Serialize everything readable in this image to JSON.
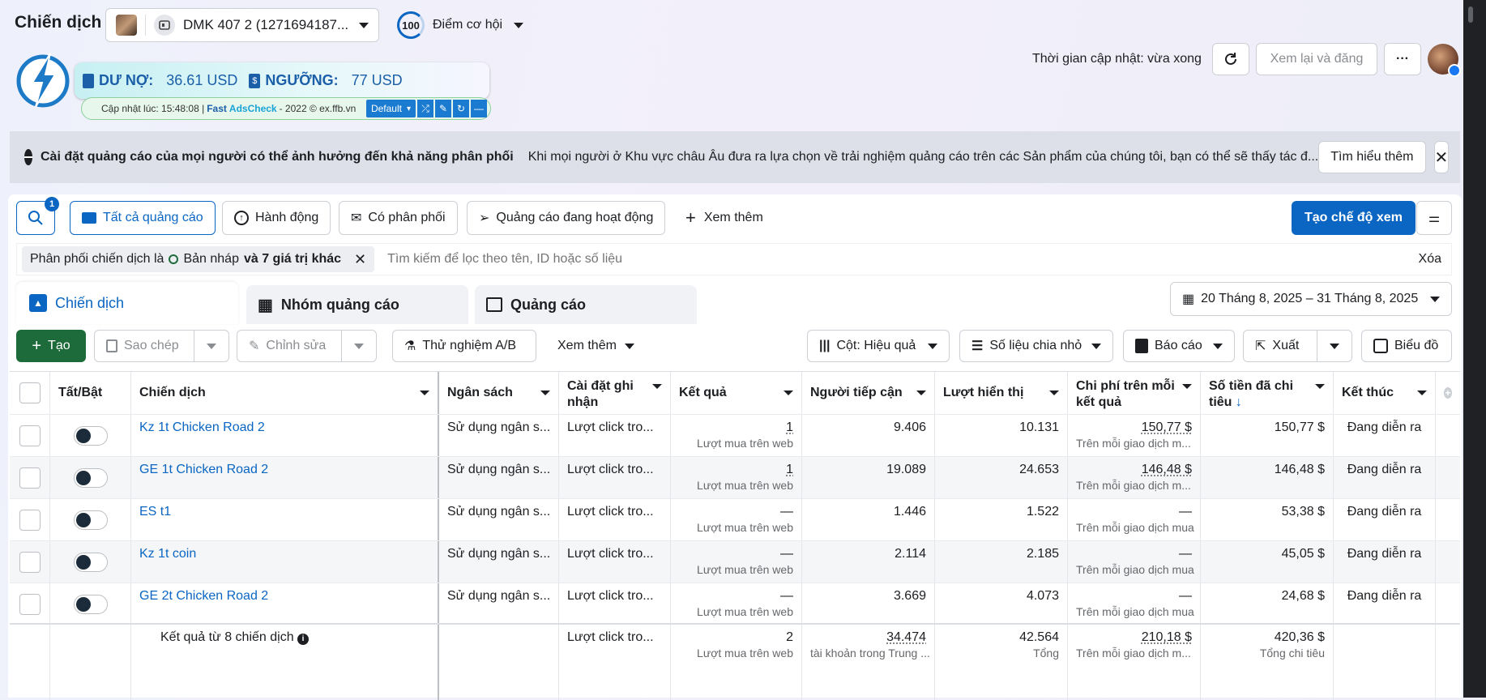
{
  "header": {
    "title": "Chiến dịch",
    "account_name": "DMK 407 2 (1271694187...",
    "score_value": "100",
    "score_label": "Điểm cơ hội",
    "update_time": "Thời gian cập nhật: vừa xong",
    "review_publish": "Xem lại và đăng"
  },
  "adscheck": {
    "debt_label": "DƯ NỢ:",
    "debt_value": "36.61 USD",
    "threshold_label": "NGƯỠNG:",
    "threshold_value": "77 USD",
    "footer_prefix": "Cập nhật lúc: 15:48:08 |",
    "footer_brand_fast": "Fast",
    "footer_brand_name": "AdsCheck",
    "footer_suffix": "- 2022 © ex.ffb.vn",
    "preset": "Default"
  },
  "notice": {
    "title": "Cài đặt quảng cáo của mọi người có thể ảnh hưởng đến khả năng phân phối",
    "text": "Khi mọi người ở Khu vực châu Âu đưa ra lựa chọn về trải nghiệm quảng cáo trên các Sản phẩm của chúng tôi, bạn có thể sẽ thấy tác đ...",
    "learn_more": "Tìm hiểu thêm"
  },
  "filters": {
    "search_badge": "1",
    "all_ads": "Tất cả quảng cáo",
    "actions": "Hành động",
    "delivering": "Có phân phối",
    "active_ads": "Quảng cáo đang hoạt động",
    "see_more": "Xem thêm",
    "create_view": "Tạo chế độ xem",
    "chip_prefix": "Phân phối chiến dịch là",
    "chip_draft": "Bản nháp",
    "chip_suffix": "và 7 giá trị khác",
    "search_placeholder": "Tìm kiếm để lọc theo tên, ID hoặc số liệu",
    "clear": "Xóa"
  },
  "tabs": {
    "campaigns": "Chiến dịch",
    "adsets": "Nhóm quảng cáo",
    "ads": "Quảng cáo",
    "date_range": "20 Tháng 8, 2025 – 31 Tháng 8, 2025"
  },
  "toolbar": {
    "create": "Tạo",
    "duplicate": "Sao chép",
    "edit": "Chỉnh sửa",
    "ab_test": "Thử nghiệm A/B",
    "more": "Xem thêm",
    "columns": "Cột: Hiệu quả",
    "breakdown": "Số liệu chia nhỏ",
    "reports": "Báo cáo",
    "export": "Xuất",
    "charts": "Biểu đồ"
  },
  "table": {
    "headers": {
      "toggle": "Tất/Bật",
      "campaign": "Chiến dịch",
      "budget": "Ngân sách",
      "attribution_1": "Cài đặt ghi",
      "attribution_2": "nhận",
      "results": "Kết quả",
      "reach": "Người tiếp cận",
      "impressions": "Lượt hiển thị",
      "cpr_1": "Chi phí trên mỗi",
      "cpr_2": "kết quả",
      "spent_1": "Số tiền đã chi",
      "spent_2": "tiêu",
      "ends": "Kết thúc"
    },
    "rows": [
      {
        "name": "Kz 1t Chicken Road 2",
        "budget": "Sử dụng ngân s...",
        "attribution": "Lượt click tro...",
        "result": "1",
        "result_sub": "Lượt mua trên web",
        "reach": "9.406",
        "impressions": "10.131",
        "cpr": "150,77 $",
        "cpr_sub": "Trên mỗi giao dịch m...",
        "spent": "150,77 $",
        "ends": "Đang diễn ra"
      },
      {
        "name": "GE 1t Chicken Road 2",
        "budget": "Sử dụng ngân s...",
        "attribution": "Lượt click tro...",
        "result": "1",
        "result_sub": "Lượt mua trên web",
        "reach": "19.089",
        "impressions": "24.653",
        "cpr": "146,48 $",
        "cpr_sub": "Trên mỗi giao dịch m...",
        "spent": "146,48 $",
        "ends": "Đang diễn ra"
      },
      {
        "name": "ES t1",
        "budget": "Sử dụng ngân s...",
        "attribution": "Lượt click tro...",
        "result": "—",
        "result_sub": "Lượt mua trên web",
        "reach": "1.446",
        "impressions": "1.522",
        "cpr": "—",
        "cpr_sub": "Trên mỗi giao dịch mua",
        "spent": "53,38 $",
        "ends": "Đang diễn ra"
      },
      {
        "name": "Kz 1t coin",
        "budget": "Sử dụng ngân s...",
        "attribution": "Lượt click tro...",
        "result": "—",
        "result_sub": "Lượt mua trên web",
        "reach": "2.114",
        "impressions": "2.185",
        "cpr": "—",
        "cpr_sub": "Trên mỗi giao dịch mua",
        "spent": "45,05 $",
        "ends": "Đang diễn ra"
      },
      {
        "name": "GE 2t Chicken Road 2",
        "budget": "Sử dụng ngân s...",
        "attribution": "Lượt click tro...",
        "result": "—",
        "result_sub": "Lượt mua trên web",
        "reach": "3.669",
        "impressions": "4.073",
        "cpr": "—",
        "cpr_sub": "Trên mỗi giao dịch mua",
        "spent": "24,68 $",
        "ends": "Đang diễn ra"
      }
    ],
    "summary": {
      "label": "Kết quả từ 8 chiến dịch",
      "attribution": "Lượt click tro...",
      "result": "2",
      "result_sub": "Lượt mua trên web",
      "reach": "34.474",
      "reach_sub": "tài khoản trong Trung ...",
      "impressions": "42.564",
      "impressions_sub": "Tổng",
      "cpr": "210,18 $",
      "cpr_sub": "Trên mỗi giao dịch m...",
      "spent": "420,36 $",
      "spent_sub": "Tổng chi tiêu"
    }
  },
  "colors": {
    "primary": "#0a66c2",
    "create_green": "#1d6a3a",
    "debt_text": "#1a5fa8"
  }
}
